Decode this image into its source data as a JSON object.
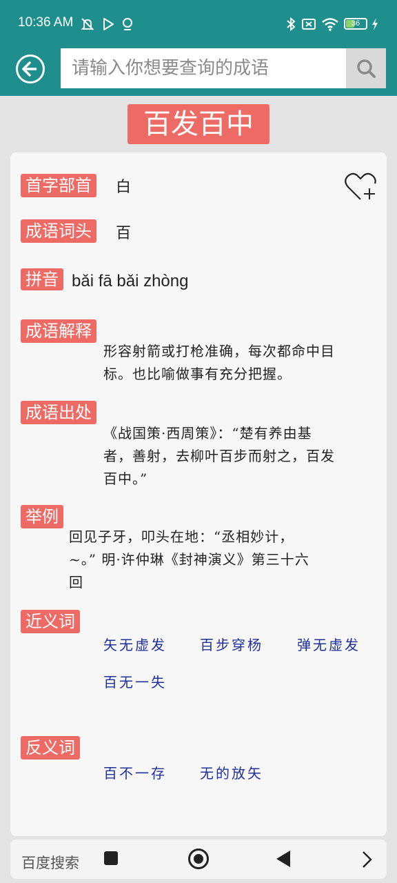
{
  "status": {
    "time": "10:36 AM",
    "battery": "36",
    "icons": [
      "mute-icon",
      "play-icon",
      "notification-icon",
      "bluetooth-icon",
      "sim-icon",
      "wifi-icon",
      "battery-icon",
      "charging-icon"
    ]
  },
  "search": {
    "placeholder": "请输入你想要查询的成语"
  },
  "idiom": {
    "title": "百发百中",
    "radical_label": "首字部首",
    "radical": "白",
    "head_label": "成语词头",
    "head": "百",
    "pinyin_label": "拼音",
    "pinyin": "bǎi fā bǎi zhòng",
    "meaning_label": "成语解释",
    "meaning_lines": [
      " 形容射箭或打枪准确，每次都命中目",
      "标。也比喻做事有充分把握。"
    ],
    "source_label": "成语出处",
    "source_lines": [
      " 《战国策·西周策》：“楚有养由基",
      "者，善射，去柳叶百步而射之，百发",
      "百中。”"
    ],
    "example_label": "举例",
    "example_lines": [
      " 回见子牙，叩头在地：“丞相妙计，",
      "~。” 明·许仲琳《封神演义》第三十六",
      "回"
    ],
    "synonyms_label": "近义词",
    "synonyms": [
      "矢无虚发",
      "百步穿杨",
      "弹无虚发",
      "百无一失"
    ],
    "antonyms_label": "反义词",
    "antonyms": [
      "百不一存",
      "无的放矢"
    ]
  },
  "navbar": {
    "search_label": "百度搜索"
  },
  "colors": {
    "header": "#1f8f8d",
    "accent": "#ee6a64",
    "link": "#1e2f9a"
  }
}
